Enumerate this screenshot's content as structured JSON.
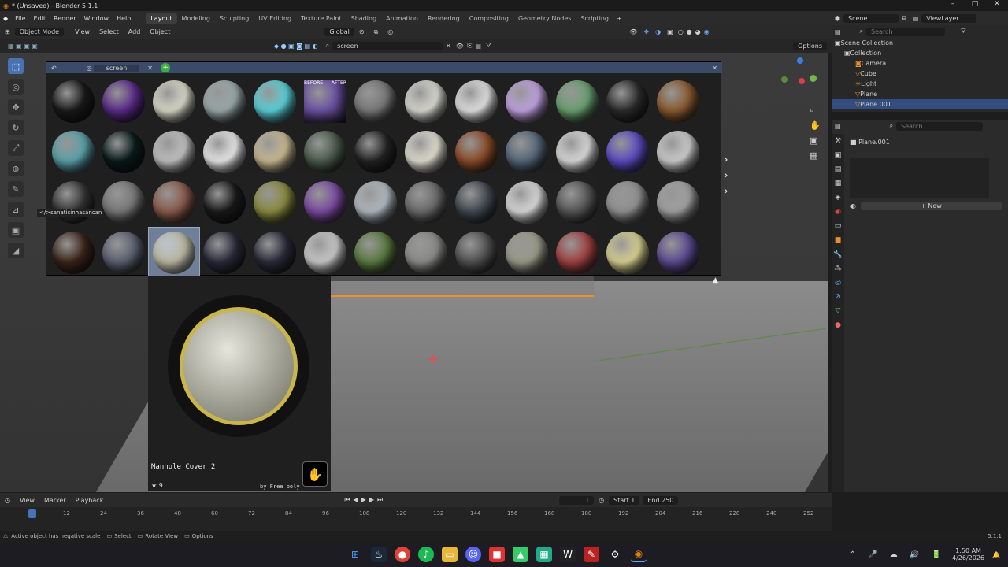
{
  "window": {
    "title": "* (Unsaved) - Blender 5.1.1",
    "controls": [
      "–",
      "□",
      "✕"
    ]
  },
  "menu": {
    "items": [
      "File",
      "Edit",
      "Render",
      "Window",
      "Help"
    ]
  },
  "workspaces": [
    "Layout",
    "Modeling",
    "Sculpting",
    "UV Editing",
    "Texture Paint",
    "Shading",
    "Animation",
    "Rendering",
    "Compositing",
    "Geometry Nodes",
    "Scripting"
  ],
  "active_workspace": "Layout",
  "scene": {
    "name": "Scene",
    "view_layer": "ViewLayer"
  },
  "viewport_header": {
    "mode": "Object Mode",
    "menus": [
      "View",
      "Select",
      "Add",
      "Object"
    ],
    "orientation": "Global",
    "search_value": "screen",
    "options_label": "Options"
  },
  "asset_browser": {
    "tab_label": "screen",
    "materials": [
      {
        "color": "#1a1a1a"
      },
      {
        "color": "#5a2a8a"
      },
      {
        "color": "#d8d8c8"
      },
      {
        "color": "#9aa8a8"
      },
      {
        "color": "#5ad0d8"
      },
      {
        "color": "#6a50a0",
        "before_label": "BEFORE",
        "after_label": "AFTER"
      },
      {
        "color": "#777777"
      },
      {
        "color": "#d8d8d0"
      },
      {
        "color": "#e0e0e0"
      },
      {
        "color": "#c0a0e0"
      },
      {
        "color": "#6aa070"
      },
      {
        "color": "#2a2a2a"
      },
      {
        "color": "#8a5a30"
      },
      {
        "color": "#5aa0a8"
      },
      {
        "color": "#0a1a1a"
      },
      {
        "color": "#c0c0c0"
      },
      {
        "color": "#e8e8e8"
      },
      {
        "color": "#c8b890"
      },
      {
        "color": "#4a5a4a"
      },
      {
        "color": "#222222"
      },
      {
        "color": "#e0dcd0"
      },
      {
        "color": "#8a4a28"
      },
      {
        "color": "#556677"
      },
      {
        "color": "#d8d8d8"
      },
      {
        "color": "#5a4ac0"
      },
      {
        "color": "#cccccc"
      },
      {
        "color": "#333333"
      },
      {
        "color": "#777777"
      },
      {
        "color": "#8a5a4a"
      },
      {
        "color": "#1a1a1a"
      },
      {
        "color": "#8a8a40"
      },
      {
        "color": "#7a4aa0"
      },
      {
        "color": "#b0b8c0"
      },
      {
        "color": "#6a6a6a"
      },
      {
        "color": "#404850"
      },
      {
        "color": "#d8d8d8"
      },
      {
        "color": "#555555"
      },
      {
        "color": "#909090"
      },
      {
        "color": "#a0a0a0"
      },
      {
        "color": "#3a2418"
      },
      {
        "color": "#5a6070"
      },
      {
        "color": "#bab6a0"
      },
      {
        "color": "#2a2a3a"
      },
      {
        "color": "#2a2a3a"
      },
      {
        "color": "#c8c8c8"
      },
      {
        "color": "#5a7a40"
      },
      {
        "color": "#8a8a88"
      },
      {
        "color": "#505050"
      },
      {
        "color": "#9a9a88"
      },
      {
        "color": "#a04040"
      },
      {
        "color": "#d8d090"
      },
      {
        "color": "#5a4a90"
      }
    ],
    "selected_index": 41,
    "user_tooltip": "</>sanaticinhasancan"
  },
  "preview": {
    "name": "Manhole Cover 2",
    "stars": "9",
    "author": "by Free poly"
  },
  "outliner": {
    "search_placeholder": "Search",
    "scene_collection": "Scene Collection",
    "collection": "Collection",
    "items": [
      "Camera",
      "Cube",
      "Light",
      "Plane",
      "Plane.001"
    ],
    "selected": "Plane.001"
  },
  "properties": {
    "search_placeholder": "Search",
    "object": "Plane.001",
    "new_label": "New"
  },
  "timeline": {
    "menus": [
      "View",
      "Marker",
      "Playback"
    ],
    "current_frame": "1",
    "start_label": "Start",
    "start": "1",
    "end_label": "End",
    "end": "250",
    "ticks": [
      "1",
      "12",
      "24",
      "36",
      "48",
      "60",
      "72",
      "84",
      "96",
      "108",
      "120",
      "132",
      "144",
      "156",
      "168",
      "180",
      "192",
      "204",
      "216",
      "228",
      "240",
      "252"
    ]
  },
  "status": {
    "message": "Active object has negative scale",
    "select": "Select",
    "rotate": "Rotate View",
    "options": "Options",
    "version": "5.1.1"
  },
  "taskbar": {
    "time": "1:50 AM",
    "date": "4/26/2026"
  }
}
